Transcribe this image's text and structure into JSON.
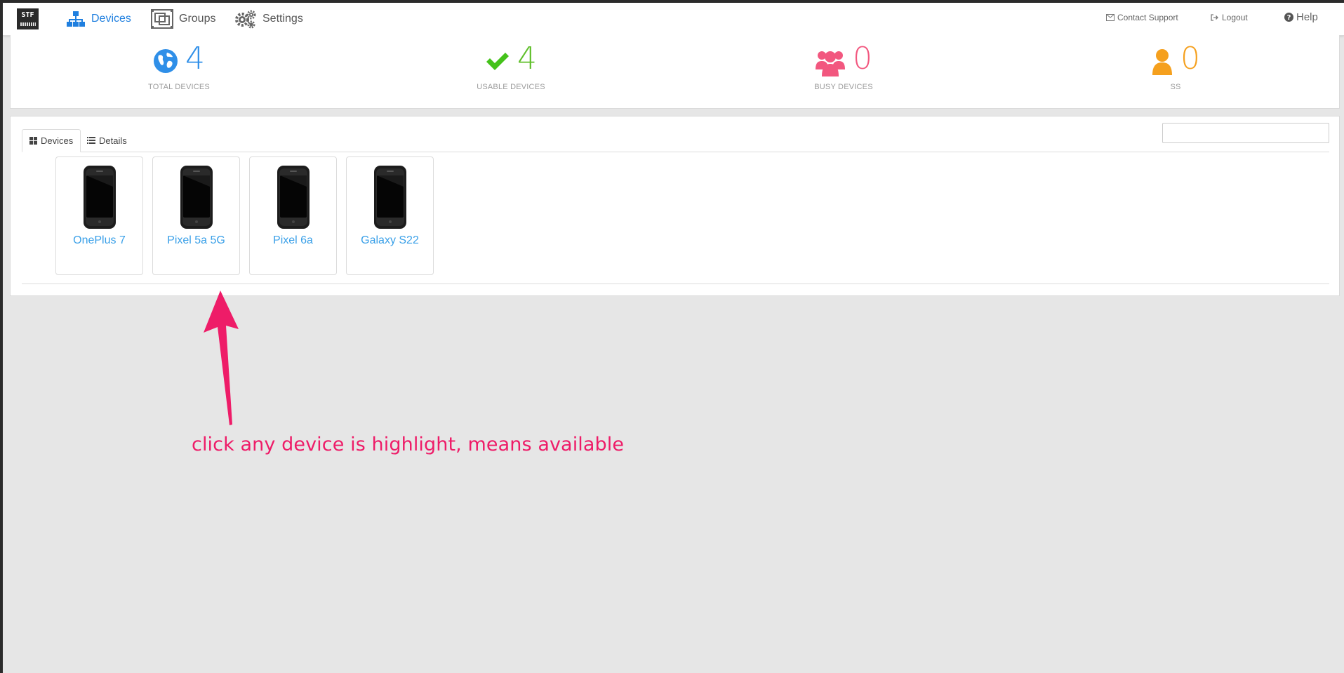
{
  "navbar": {
    "logo_text": "STF",
    "items": [
      {
        "label": "Devices",
        "icon": "sitemap-icon",
        "active": true
      },
      {
        "label": "Groups",
        "icon": "groups-icon",
        "active": false
      },
      {
        "label": "Settings",
        "icon": "gear-icon",
        "active": false
      }
    ],
    "contact_support": "Contact Support",
    "logout": "Logout",
    "help": "Help"
  },
  "stats": [
    {
      "value": "4",
      "label": "TOTAL DEVICES",
      "icon": "globe-icon",
      "color": "#2f8fe8"
    },
    {
      "value": "4",
      "label": "USABLE DEVICES",
      "icon": "check-icon",
      "color": "#5fbf2a"
    },
    {
      "value": "0",
      "label": "BUSY DEVICES",
      "icon": "users-icon",
      "color": "#f2577f"
    },
    {
      "value": "0",
      "label": "SS",
      "icon": "user-icon",
      "color": "#f5a01e"
    }
  ],
  "tabs": [
    {
      "label": "Devices",
      "icon": "grid-icon",
      "active": true
    },
    {
      "label": "Details",
      "icon": "list-icon",
      "active": false
    }
  ],
  "search": {
    "value": "",
    "placeholder": ""
  },
  "devices": [
    {
      "name": "OnePlus 7"
    },
    {
      "name": "Pixel 5a 5G"
    },
    {
      "name": "Pixel 6a"
    },
    {
      "name": "Galaxy S22"
    }
  ],
  "annotation": {
    "text": "click any device is highlight, means available",
    "color": "#ee1c68"
  }
}
